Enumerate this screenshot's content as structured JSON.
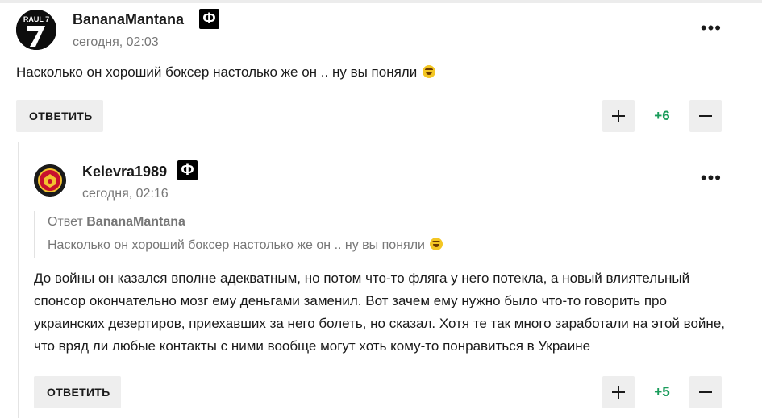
{
  "comments": [
    {
      "avatar": {
        "text": "RAUL 7"
      },
      "username": "BananaMantana",
      "badge": "Ф",
      "time": "сегодня, 02:03",
      "text": "Насколько он хороший боксер настолько же он .. ну вы поняли",
      "emoji": "grin-sweat-icon",
      "reply_label": "ОТВЕТИТЬ",
      "score": "+6"
    },
    {
      "username": "Kelevra1989",
      "badge": "Ф",
      "time": "сегодня, 02:16",
      "quote": {
        "prefix": "Ответ",
        "author": "BananaMantana",
        "text": "Насколько он хороший боксер настолько же он .. ну вы поняли"
      },
      "text": "До войны он казался вполне адекватным, но потом что-то фляга у него потекла, а новый влиятельный спонсор окончательно мозг ему деньгами заменил. Вот зачем ему нужно было что-то говорить про украинских дезертиров, приехавших за него болеть, но сказал. Хотя те так много заработали на этой войне, что вряд ли любые контакты с ними вообще могут хоть кому-то понравиться в Украине",
      "reply_label": "ОТВЕТИТЬ",
      "score": "+5"
    }
  ],
  "colors": {
    "score": "#1a9c5b",
    "button_bg": "#eeeeee",
    "muted": "#777777"
  }
}
